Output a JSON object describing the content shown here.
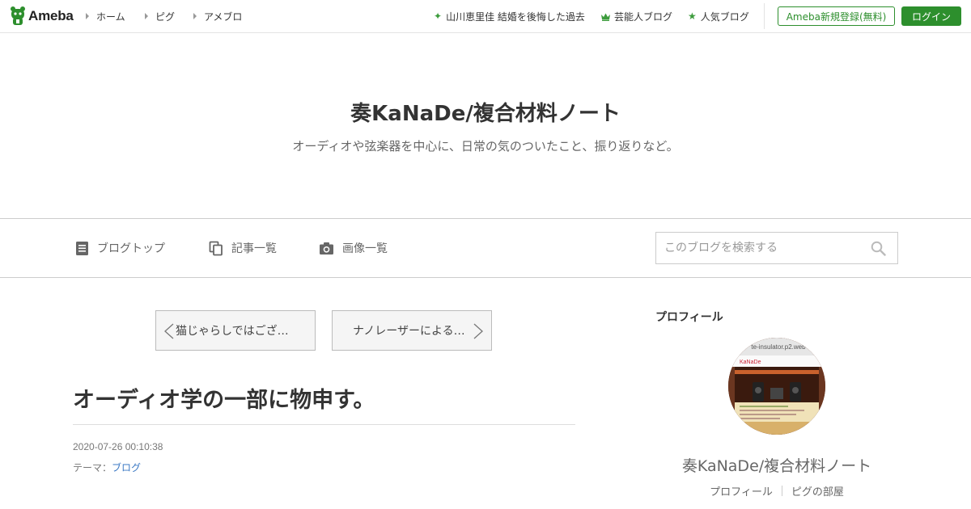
{
  "topbar": {
    "logo_text": "Ameba",
    "nav": [
      "ホーム",
      "ピグ",
      "アメブロ"
    ],
    "trend_link": "山川恵里佳 結婚を後悔した過去",
    "celebrity_link": "芸能人ブログ",
    "popular_link": "人気ブログ",
    "register_label": "Ameba新規登録(無料)",
    "login_label": "ログイン",
    "brand_color": "#2d8f2d"
  },
  "header": {
    "title": "奏KaNaDe/複合材料ノート",
    "description": "オーディオや弦楽器を中心に、日常の気のついたこと、振り返りなど。"
  },
  "blognav": {
    "top_label": "ブログトップ",
    "entries_label": "記事一覧",
    "images_label": "画像一覧",
    "search_placeholder": "このブログを検索する"
  },
  "pager": {
    "prev_label": "猫じゃらしではござ…",
    "next_label": "ナノレーザーによる…"
  },
  "entry": {
    "title": "オーディオ学の一部に物申す。",
    "date": "2020-07-26 00:10:38",
    "theme_prefix": "テーマ：",
    "theme_link": "ブログ"
  },
  "sidebar": {
    "heading": "プロフィール",
    "avatar_caption": "te-insulator.p2.web",
    "avatar_logo": "KaNaDe",
    "name": "奏KaNaDe/複合材料ノート",
    "profile_link": "プロフィール",
    "pig_link": "ピグの部屋"
  }
}
